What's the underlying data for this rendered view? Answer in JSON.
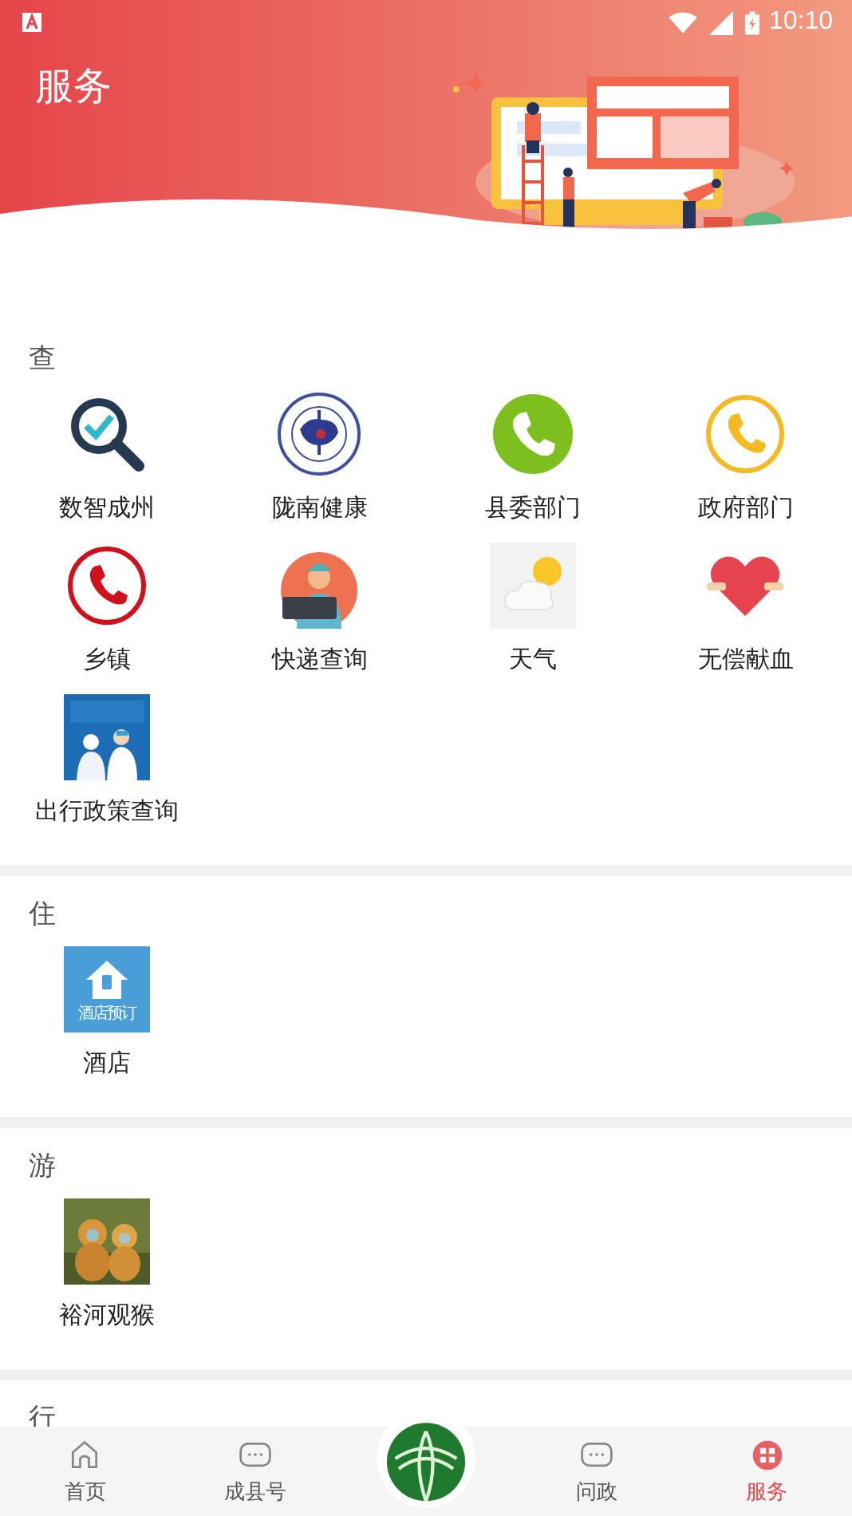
{
  "status_bar": {
    "time": "10:10"
  },
  "header": {
    "title": "服务"
  },
  "sections": [
    {
      "heading": "查",
      "items": [
        {
          "label": "数智成州",
          "kind": "magnifier"
        },
        {
          "label": "陇南健康",
          "kind": "emblem"
        },
        {
          "label": "县委部门",
          "kind": "phone-filled",
          "color": "#7cbf1e"
        },
        {
          "label": "政府部门",
          "kind": "phone-ring",
          "color": "#f5b923"
        },
        {
          "label": "乡镇",
          "kind": "phone-ring",
          "color": "#d0101b"
        },
        {
          "label": "快递查询",
          "kind": "courier"
        },
        {
          "label": "天气",
          "kind": "weather"
        },
        {
          "label": "无偿献血",
          "kind": "heart"
        },
        {
          "label": "出行政策查询",
          "kind": "picture"
        }
      ]
    },
    {
      "heading": "住",
      "items": [
        {
          "label": "酒店",
          "kind": "hotel",
          "caption": "酒店预订"
        }
      ]
    },
    {
      "heading": "游",
      "items": [
        {
          "label": "裕河观猴",
          "kind": "picture"
        }
      ]
    },
    {
      "heading": "行"
    }
  ],
  "bottom_nav": [
    {
      "label": "首页",
      "kind": "home",
      "selected": false
    },
    {
      "label": "成县号",
      "kind": "chat",
      "selected": false
    },
    {
      "kind": "logo",
      "selected": false
    },
    {
      "label": "问政",
      "kind": "chat",
      "selected": false
    },
    {
      "label": "服务",
      "kind": "grid",
      "selected": true
    }
  ]
}
